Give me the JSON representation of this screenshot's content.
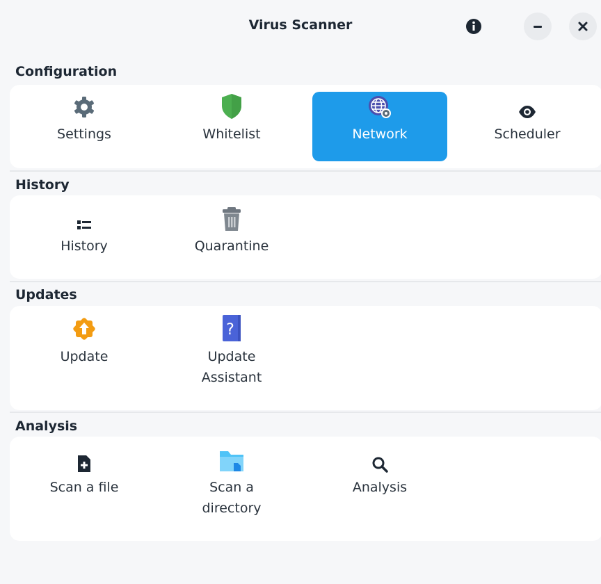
{
  "window": {
    "title": "Virus Scanner"
  },
  "titlebar": {
    "info_icon": "info-icon",
    "minimize_icon": "minimize-icon",
    "close_icon": "close-icon"
  },
  "sections": {
    "configuration": {
      "title": "Configuration",
      "items": [
        {
          "label": "Settings",
          "icon": "gear-icon"
        },
        {
          "label": "Whitelist",
          "icon": "shield-icon"
        },
        {
          "label": "Network",
          "icon": "network-settings-icon",
          "selected": true
        },
        {
          "label": "Scheduler",
          "icon": "eye-icon"
        }
      ]
    },
    "history": {
      "title": "History",
      "items": [
        {
          "label": "History",
          "icon": "list-icon"
        },
        {
          "label": "Quarantine",
          "icon": "trash-icon"
        }
      ]
    },
    "updates": {
      "title": "Updates",
      "items": [
        {
          "label": "Update",
          "icon": "update-badge-icon"
        },
        {
          "label": "Update Assistant",
          "icon": "help-book-icon"
        }
      ]
    },
    "analysis": {
      "title": "Analysis",
      "items": [
        {
          "label": "Scan a file",
          "icon": "file-plus-icon"
        },
        {
          "label": "Scan a directory",
          "icon": "folder-icon"
        },
        {
          "label": "Analysis",
          "icon": "search-icon"
        }
      ]
    }
  },
  "colors": {
    "accent": "#1e9bea",
    "background": "#f6f7f9",
    "card": "#ffffff",
    "shield": "#4caf50",
    "update": "#f39c12",
    "book": "#4a63d8",
    "folder": "#4fc3f7"
  }
}
